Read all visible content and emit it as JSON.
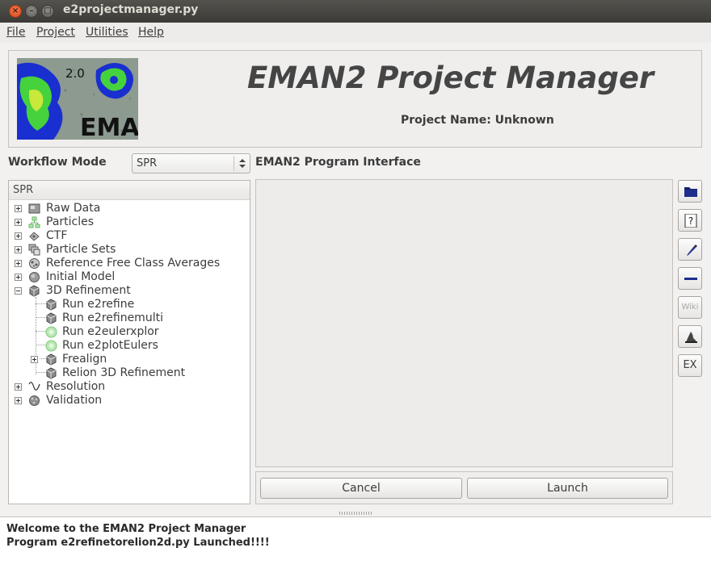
{
  "window": {
    "title": "e2projectmanager.py"
  },
  "menubar": {
    "items": [
      "File",
      "Project",
      "Utilities",
      "Help"
    ]
  },
  "banner": {
    "logo_version": "2.0",
    "logo_text": "EMAN",
    "title": "EMAN2 Project Manager",
    "project_name": "Project Name: Unknown"
  },
  "workflow": {
    "label": "Workflow Mode",
    "selected": "SPR"
  },
  "program_interface": {
    "label": "EMAN2 Program Interface"
  },
  "tree": {
    "header": "SPR",
    "items": [
      {
        "label": "Raw Data",
        "icon": "raw-data-icon"
      },
      {
        "label": "Particles",
        "icon": "particles-icon"
      },
      {
        "label": "CTF",
        "icon": "ctf-icon"
      },
      {
        "label": "Particle Sets",
        "icon": "particle-sets-icon"
      },
      {
        "label": "Reference Free Class Averages",
        "icon": "class-averages-icon"
      },
      {
        "label": "Initial Model",
        "icon": "initial-model-icon"
      },
      {
        "label": "3D Refinement",
        "icon": "refinement-icon"
      },
      {
        "label": "Run e2refine",
        "icon": "refinement-icon"
      },
      {
        "label": "Run e2refinemulti",
        "icon": "refinement-icon"
      },
      {
        "label": "Run e2eulerxplor",
        "icon": "euler-icon"
      },
      {
        "label": "Run e2plotEulers",
        "icon": "euler-icon"
      },
      {
        "label": "Frealign",
        "icon": "refinement-icon"
      },
      {
        "label": "Relion 3D Refinement",
        "icon": "refinement-icon"
      },
      {
        "label": "Resolution",
        "icon": "resolution-icon"
      },
      {
        "label": "Validation",
        "icon": "validation-icon"
      }
    ]
  },
  "buttons": {
    "cancel": "Cancel",
    "launch": "Launch"
  },
  "toolbar": {
    "help_glyph": "?",
    "wiki_label": "Wiki",
    "expert_label": "EX"
  },
  "log": {
    "lines": [
      "Welcome to the EMAN2 Project Manager",
      "Program e2refinetorelion2d.py Launched!!!!"
    ]
  },
  "colors": {
    "close_button": "#e9541f",
    "logo_blue": "#1e3cff",
    "logo_green": "#46d23c"
  }
}
